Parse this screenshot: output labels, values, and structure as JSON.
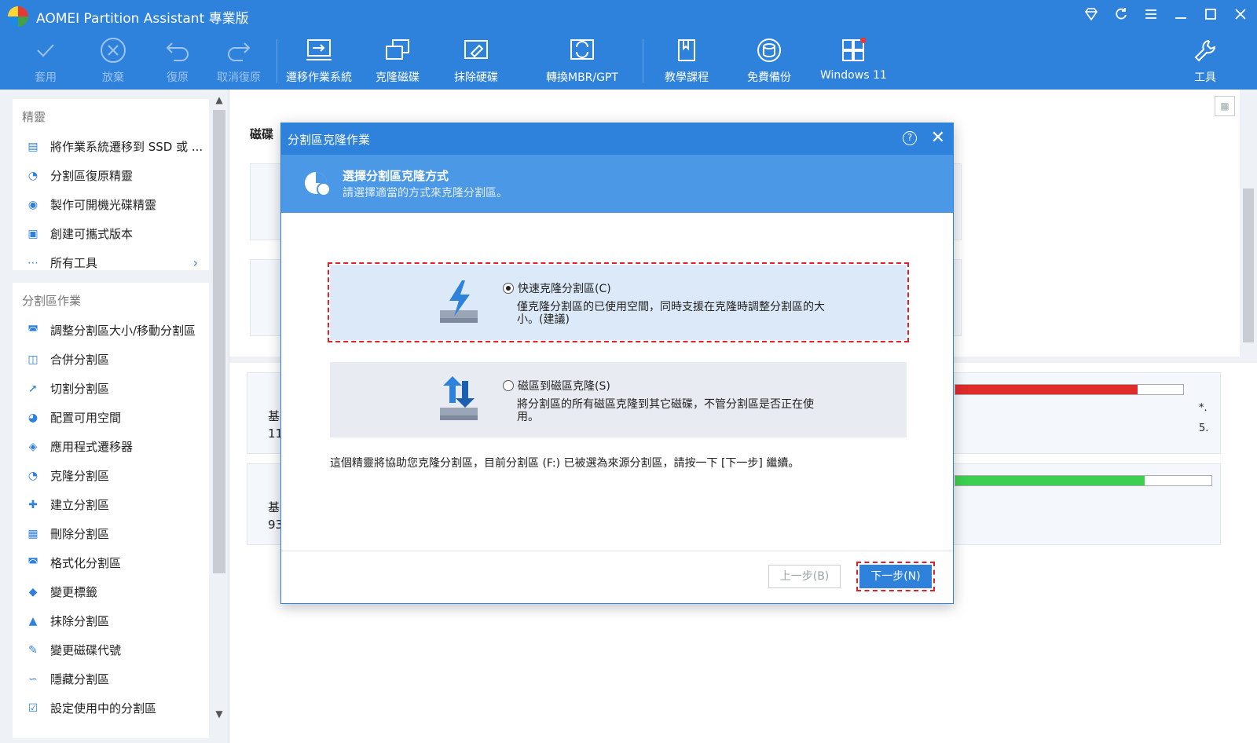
{
  "window": {
    "title": "AOMEI Partition Assistant 專業版"
  },
  "toolbar": {
    "apply": "套用",
    "discard": "放棄",
    "undo": "復原",
    "redo": "取消復原",
    "migrate_os": "遷移作業系統",
    "clone_disk": "克隆磁碟",
    "wipe_disk": "抹除硬碟",
    "convert_mbr_gpt": "轉換MBR/GPT",
    "tutorial": "教學課程",
    "free_backup": "免費備份",
    "windows11": "Windows 11",
    "tools": "工具"
  },
  "sidebar": {
    "wizard_heading": "精靈",
    "wizard_items": [
      {
        "label": "將作業系統遷移到 SSD 或 ...",
        "icon": "migrate-os-icon"
      },
      {
        "label": "分割區復原精靈",
        "icon": "partition-recovery-icon"
      },
      {
        "label": "製作可開機光碟精靈",
        "icon": "bootable-media-icon"
      },
      {
        "label": "創建可攜式版本",
        "icon": "portable-version-icon"
      },
      {
        "label": "所有工具",
        "icon": "more-tools-icon"
      }
    ],
    "ops_heading": "分割區作業",
    "ops_items": [
      {
        "label": "調整分割區大小/移動分割區",
        "icon": "resize-partition-icon"
      },
      {
        "label": "合併分割區",
        "icon": "merge-partition-icon"
      },
      {
        "label": "切割分割區",
        "icon": "split-partition-icon"
      },
      {
        "label": "配置可用空間",
        "icon": "allocate-space-icon"
      },
      {
        "label": "應用程式遷移器",
        "icon": "app-mover-icon"
      },
      {
        "label": "克隆分割區",
        "icon": "clone-partition-icon"
      },
      {
        "label": "建立分割區",
        "icon": "create-partition-icon"
      },
      {
        "label": "刪除分割區",
        "icon": "delete-partition-icon"
      },
      {
        "label": "格式化分割區",
        "icon": "format-partition-icon"
      },
      {
        "label": "變更標籤",
        "icon": "change-label-icon"
      },
      {
        "label": "抹除分割區",
        "icon": "wipe-partition-icon"
      },
      {
        "label": "變更磁碟代號",
        "icon": "change-drive-letter-icon"
      },
      {
        "label": "隱藏分割區",
        "icon": "hide-partition-icon"
      },
      {
        "label": "設定使用中的分割區",
        "icon": "set-active-partition-icon"
      }
    ]
  },
  "main": {
    "disk_label_partial": "磁碟",
    "disk_rows": [
      {
        "type_partial": "基",
        "size_partial": "11",
        "usage": 0.8,
        "color": "#e02b2b"
      },
      {
        "type_partial": "基",
        "size_partial": "93",
        "usage": 0.74,
        "color": "#3ccf50"
      }
    ],
    "side_info": {
      "star": "*.",
      "val": "5."
    }
  },
  "dialog": {
    "title": "分割區克隆作業",
    "banner_title": "選擇分割區克隆方式",
    "banner_subtitle": "請選擇適當的方式來克隆分割區。",
    "options": [
      {
        "title": "快速克隆分割區(C)",
        "desc": "僅克隆分割區的已使用空間，同時支援在克隆時調整分割區的大小。(建議)",
        "selected": true
      },
      {
        "title": "磁區到磁區克隆(S)",
        "desc": "將分割區的所有磁區克隆到其它磁碟，不管分割區是否正在使用。",
        "selected": false
      }
    ],
    "note": "這個精靈將協助您克隆分割區，目前分割區 (F:) 已被選為來源分割區，請按一下 [下一步] 繼續。",
    "back_button": "上一步(B)",
    "next_button": "下一步(N)"
  }
}
